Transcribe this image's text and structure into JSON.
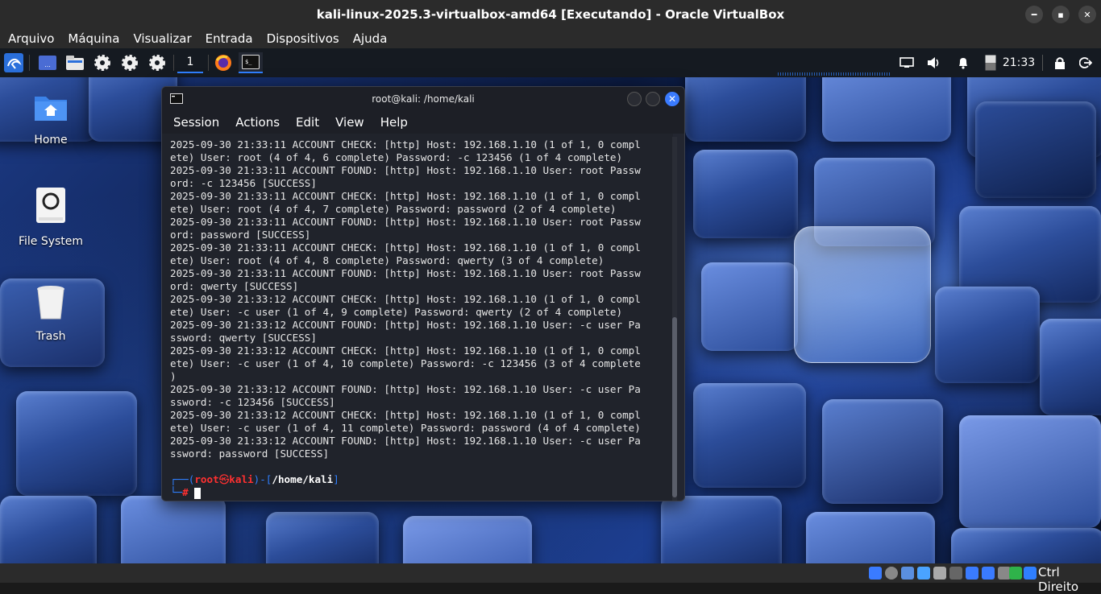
{
  "vbox": {
    "title": "kali-linux-2025.3-virtualbox-amd64 [Executando] - Oracle VirtualBox",
    "menu": [
      "Arquivo",
      "Máquina",
      "Visualizar",
      "Entrada",
      "Dispositivos",
      "Ajuda"
    ],
    "host_key": "Ctrl Direito"
  },
  "panel": {
    "workspace": "1",
    "clock": "21:33"
  },
  "desktop_icons": [
    {
      "label": "Home"
    },
    {
      "label": "File System"
    },
    {
      "label": "Trash"
    }
  ],
  "terminal": {
    "title": "root@kali: /home/kali",
    "menu": [
      "Session",
      "Actions",
      "Edit",
      "View",
      "Help"
    ],
    "lines": [
      "2025-09-30 21:33:11 ACCOUNT CHECK: [http] Host: 192.168.1.10 (1 of 1, 0 compl",
      "ete) User: root (4 of 4, 6 complete) Password: -c 123456 (1 of 4 complete)",
      "2025-09-30 21:33:11 ACCOUNT FOUND: [http] Host: 192.168.1.10 User: root Passw",
      "ord: -c 123456 [SUCCESS]",
      "2025-09-30 21:33:11 ACCOUNT CHECK: [http] Host: 192.168.1.10 (1 of 1, 0 compl",
      "ete) User: root (4 of 4, 7 complete) Password: password (2 of 4 complete)",
      "2025-09-30 21:33:11 ACCOUNT FOUND: [http] Host: 192.168.1.10 User: root Passw",
      "ord: password [SUCCESS]",
      "2025-09-30 21:33:11 ACCOUNT CHECK: [http] Host: 192.168.1.10 (1 of 1, 0 compl",
      "ete) User: root (4 of 4, 8 complete) Password: qwerty (3 of 4 complete)",
      "2025-09-30 21:33:11 ACCOUNT FOUND: [http] Host: 192.168.1.10 User: root Passw",
      "ord: qwerty [SUCCESS]",
      "2025-09-30 21:33:12 ACCOUNT CHECK: [http] Host: 192.168.1.10 (1 of 1, 0 compl",
      "ete) User: -c user (1 of 4, 9 complete) Password: qwerty (2 of 4 complete)",
      "2025-09-30 21:33:12 ACCOUNT FOUND: [http] Host: 192.168.1.10 User: -c user Pa",
      "ssword: qwerty [SUCCESS]",
      "2025-09-30 21:33:12 ACCOUNT CHECK: [http] Host: 192.168.1.10 (1 of 1, 0 compl",
      "ete) User: -c user (1 of 4, 10 complete) Password: -c 123456 (3 of 4 complete",
      ")",
      "2025-09-30 21:33:12 ACCOUNT FOUND: [http] Host: 192.168.1.10 User: -c user Pa",
      "ssword: -c 123456 [SUCCESS]",
      "2025-09-30 21:33:12 ACCOUNT CHECK: [http] Host: 192.168.1.10 (1 of 1, 0 compl",
      "ete) User: -c user (1 of 4, 11 complete) Password: password (4 of 4 complete)",
      "2025-09-30 21:33:12 ACCOUNT FOUND: [http] Host: 192.168.1.10 User: -c user Pa",
      "ssword: password [SUCCESS]"
    ],
    "prompt": {
      "user": "root",
      "at_symbol": "㉿",
      "host": "kali",
      "path": "/home/kali",
      "hash": "#"
    }
  },
  "colors": {
    "prompt_blue": "#2f7fff",
    "prompt_red": "#ff3030",
    "close_btn": "#3a7bff"
  }
}
